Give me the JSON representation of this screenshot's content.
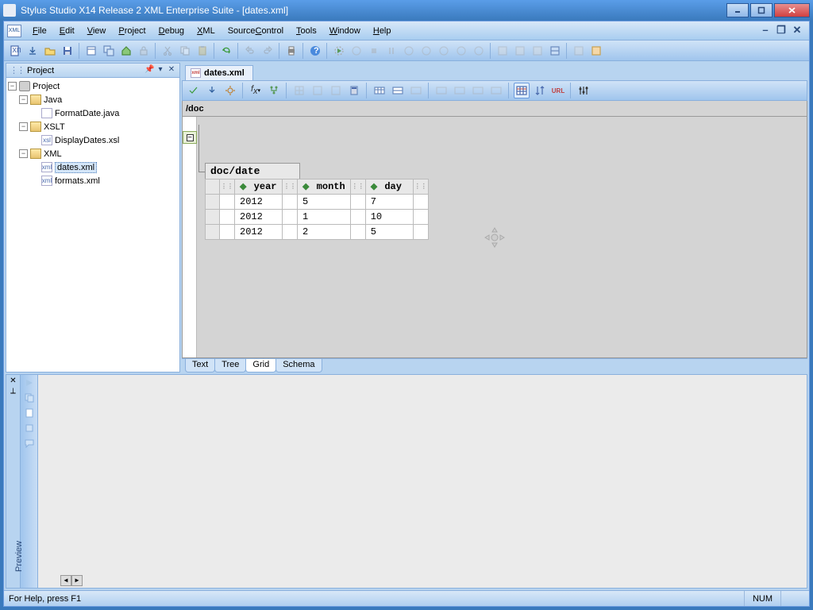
{
  "window": {
    "title": "Stylus Studio X14 Release 2 XML Enterprise Suite - [dates.xml]"
  },
  "menubar": [
    "File",
    "Edit",
    "View",
    "Project",
    "Debug",
    "XML",
    "SourceControl",
    "Tools",
    "Window",
    "Help"
  ],
  "menubar_accel": [
    0,
    0,
    0,
    0,
    0,
    0,
    6,
    0,
    0,
    0
  ],
  "project_panel": {
    "title": "Project",
    "root": "Project",
    "nodes": [
      {
        "label": "Java",
        "type": "folder",
        "depth": 1,
        "expander": "-"
      },
      {
        "label": "FormatDate.java",
        "type": "file",
        "depth": 2
      },
      {
        "label": "XSLT",
        "type": "folder",
        "depth": 1,
        "expander": "-"
      },
      {
        "label": "DisplayDates.xsl",
        "type": "file",
        "depth": 2,
        "ico": "xsl"
      },
      {
        "label": "XML",
        "type": "folder",
        "depth": 1,
        "expander": "-"
      },
      {
        "label": "dates.xml",
        "type": "file",
        "depth": 2,
        "ico": "xml",
        "selected": true
      },
      {
        "label": "formats.xml",
        "type": "file",
        "depth": 2,
        "ico": "xml"
      }
    ]
  },
  "doc_tab": {
    "label": "dates.xml"
  },
  "path_bar": "/doc",
  "grid": {
    "path_label": "doc/date",
    "columns": [
      "year",
      "month",
      "day"
    ],
    "rows": [
      {
        "year": "2012",
        "month": "5",
        "day": "7"
      },
      {
        "year": "2012",
        "month": "1",
        "day": "10"
      },
      {
        "year": "2012",
        "month": "2",
        "day": "5"
      }
    ]
  },
  "bottom_tabs": [
    "Text",
    "Tree",
    "Grid",
    "Schema"
  ],
  "bottom_active": 2,
  "statusbar": {
    "msg": "For Help, press F1",
    "num": "NUM"
  },
  "preview": {
    "label": "Preview"
  }
}
